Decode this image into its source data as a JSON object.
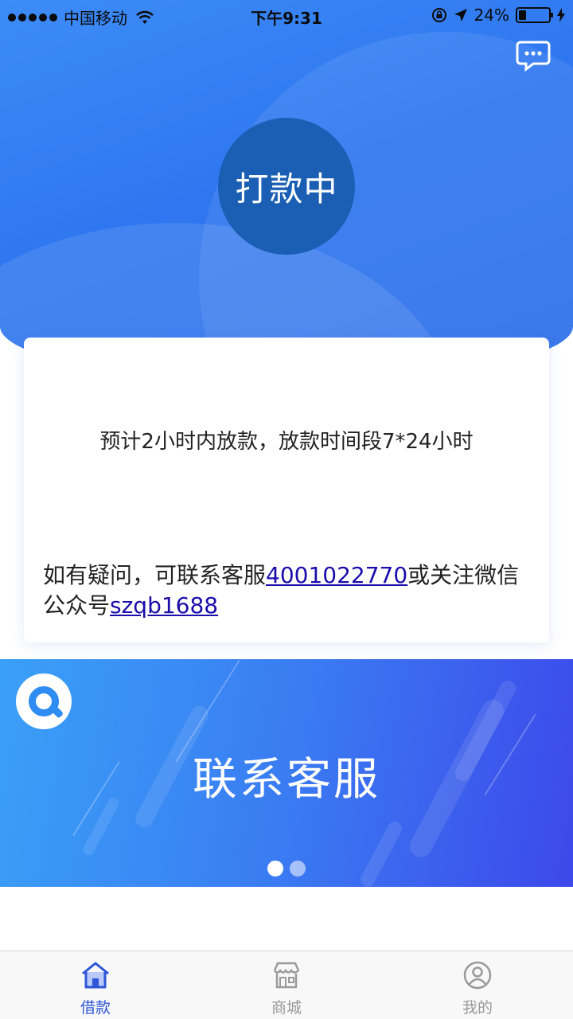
{
  "status_bar": {
    "carrier": "中国移动",
    "time": "下午9:31",
    "battery": "24%"
  },
  "hero": {
    "status": "打款中"
  },
  "card": {
    "eta": "预计2小时内放款，放款时间段7*24小时",
    "contact_prefix": "如有疑问，可联系客服",
    "phone": "4001022770",
    "contact_middle": "或关注微信公众号",
    "wechat_id": "szqb1688"
  },
  "banner": {
    "title": "联系客服",
    "active_page": 1,
    "page_count": 2
  },
  "tabs": [
    {
      "label": "借款",
      "icon": "home-icon",
      "active": true
    },
    {
      "label": "商城",
      "icon": "store-icon",
      "active": false
    },
    {
      "label": "我的",
      "icon": "user-icon",
      "active": false
    }
  ],
  "colors": {
    "primary": "#2f77f0",
    "status_circle": "#1a5fb3",
    "link": "#1a0dab",
    "tab_active": "#2f56d6",
    "tab_inactive": "#9a9a9a"
  }
}
